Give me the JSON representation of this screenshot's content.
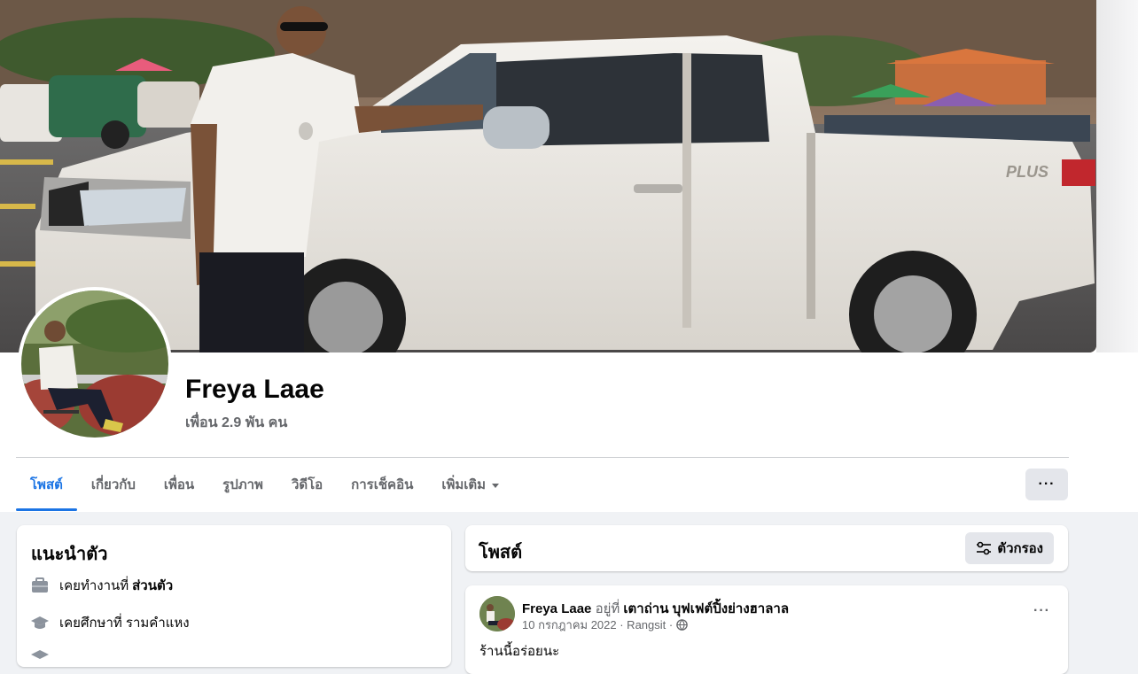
{
  "profile": {
    "name": "Freya Laae",
    "friends": "เพื่อน 2.9 พัน คน"
  },
  "tabs": [
    {
      "label": "โพสต์",
      "active": true
    },
    {
      "label": "เกี่ยวกับ",
      "active": false
    },
    {
      "label": "เพื่อน",
      "active": false
    },
    {
      "label": "รูปภาพ",
      "active": false
    },
    {
      "label": "วิดีโอ",
      "active": false
    },
    {
      "label": "การเช็คอิน",
      "active": false
    },
    {
      "label": "เพิ่มเติม",
      "active": false
    }
  ],
  "more_label": "···",
  "intro": {
    "title": "แนะนำตัว",
    "work_prefix": "เคยทำงานที่",
    "work_value": "ส่วนตัว",
    "study_prefix": "เคยศึกษาที่ รามคำแหง"
  },
  "posts": {
    "title": "โพสต์",
    "filter_label": "ตัวกรอง"
  },
  "post": {
    "author": "Freya Laae",
    "at_label": "อยู่ที่",
    "place": "เตาถ่าน บุฟเฟต์ปิ้งย่างฮาลาล",
    "meta": "10 กรกฎาคม 2022 · Rangsit ·",
    "text": "ร้านนี้อร่อยนะ",
    "menu": "···"
  },
  "colors": {
    "accent": "#1b74e4",
    "secondary_text": "#65676b",
    "button_bg": "#e4e6eb",
    "page_bg": "#f0f2f5"
  },
  "icons": [
    "briefcase-icon",
    "graduation-cap-icon",
    "globe-icon",
    "filter-sliders-icon",
    "dropdown-caret-icon"
  ]
}
